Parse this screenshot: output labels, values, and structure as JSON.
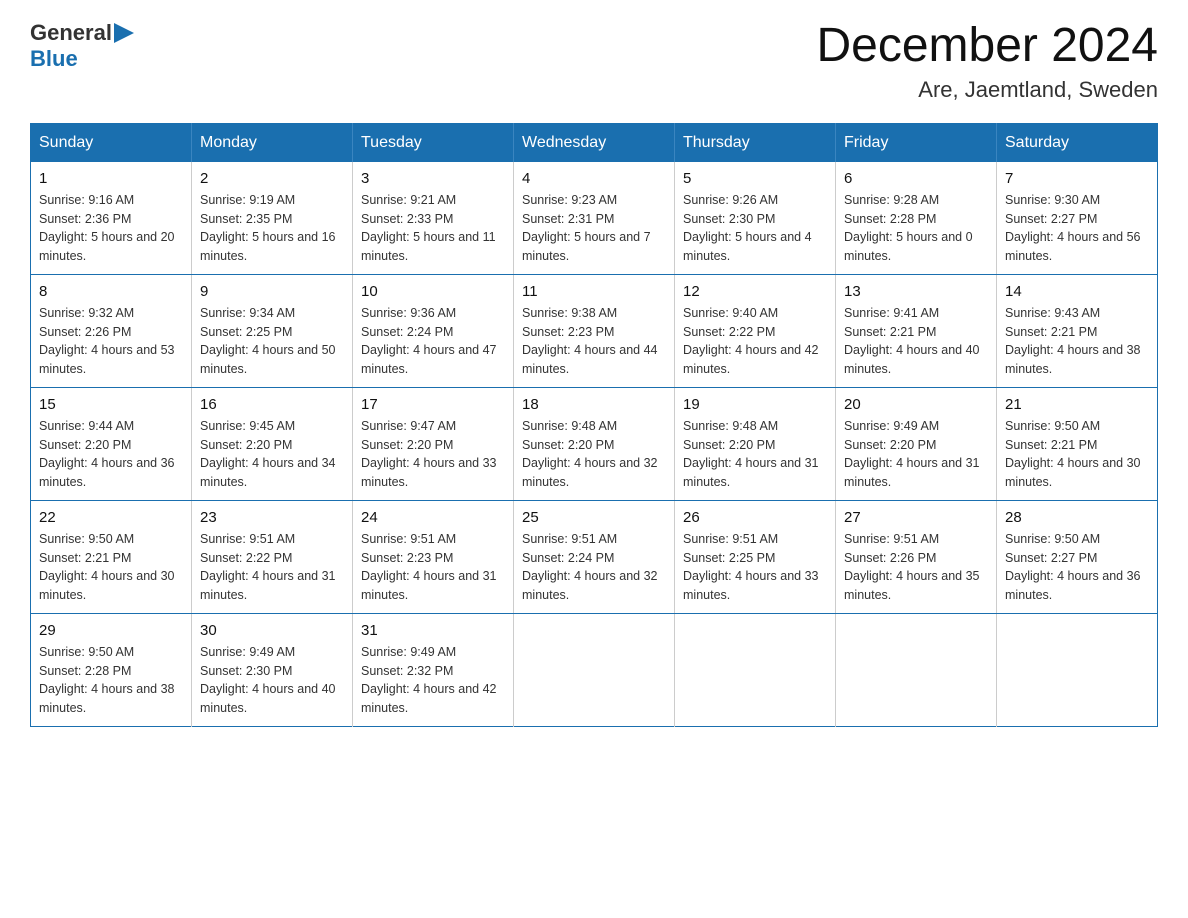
{
  "header": {
    "logo_general": "General",
    "logo_blue": "Blue",
    "month_year": "December 2024",
    "location": "Are, Jaemtland, Sweden"
  },
  "weekdays": [
    "Sunday",
    "Monday",
    "Tuesday",
    "Wednesday",
    "Thursday",
    "Friday",
    "Saturday"
  ],
  "weeks": [
    [
      {
        "day": "1",
        "sunrise": "9:16 AM",
        "sunset": "2:36 PM",
        "daylight": "5 hours and 20 minutes."
      },
      {
        "day": "2",
        "sunrise": "9:19 AM",
        "sunset": "2:35 PM",
        "daylight": "5 hours and 16 minutes."
      },
      {
        "day": "3",
        "sunrise": "9:21 AM",
        "sunset": "2:33 PM",
        "daylight": "5 hours and 11 minutes."
      },
      {
        "day": "4",
        "sunrise": "9:23 AM",
        "sunset": "2:31 PM",
        "daylight": "5 hours and 7 minutes."
      },
      {
        "day": "5",
        "sunrise": "9:26 AM",
        "sunset": "2:30 PM",
        "daylight": "5 hours and 4 minutes."
      },
      {
        "day": "6",
        "sunrise": "9:28 AM",
        "sunset": "2:28 PM",
        "daylight": "5 hours and 0 minutes."
      },
      {
        "day": "7",
        "sunrise": "9:30 AM",
        "sunset": "2:27 PM",
        "daylight": "4 hours and 56 minutes."
      }
    ],
    [
      {
        "day": "8",
        "sunrise": "9:32 AM",
        "sunset": "2:26 PM",
        "daylight": "4 hours and 53 minutes."
      },
      {
        "day": "9",
        "sunrise": "9:34 AM",
        "sunset": "2:25 PM",
        "daylight": "4 hours and 50 minutes."
      },
      {
        "day": "10",
        "sunrise": "9:36 AM",
        "sunset": "2:24 PM",
        "daylight": "4 hours and 47 minutes."
      },
      {
        "day": "11",
        "sunrise": "9:38 AM",
        "sunset": "2:23 PM",
        "daylight": "4 hours and 44 minutes."
      },
      {
        "day": "12",
        "sunrise": "9:40 AM",
        "sunset": "2:22 PM",
        "daylight": "4 hours and 42 minutes."
      },
      {
        "day": "13",
        "sunrise": "9:41 AM",
        "sunset": "2:21 PM",
        "daylight": "4 hours and 40 minutes."
      },
      {
        "day": "14",
        "sunrise": "9:43 AM",
        "sunset": "2:21 PM",
        "daylight": "4 hours and 38 minutes."
      }
    ],
    [
      {
        "day": "15",
        "sunrise": "9:44 AM",
        "sunset": "2:20 PM",
        "daylight": "4 hours and 36 minutes."
      },
      {
        "day": "16",
        "sunrise": "9:45 AM",
        "sunset": "2:20 PM",
        "daylight": "4 hours and 34 minutes."
      },
      {
        "day": "17",
        "sunrise": "9:47 AM",
        "sunset": "2:20 PM",
        "daylight": "4 hours and 33 minutes."
      },
      {
        "day": "18",
        "sunrise": "9:48 AM",
        "sunset": "2:20 PM",
        "daylight": "4 hours and 32 minutes."
      },
      {
        "day": "19",
        "sunrise": "9:48 AM",
        "sunset": "2:20 PM",
        "daylight": "4 hours and 31 minutes."
      },
      {
        "day": "20",
        "sunrise": "9:49 AM",
        "sunset": "2:20 PM",
        "daylight": "4 hours and 31 minutes."
      },
      {
        "day": "21",
        "sunrise": "9:50 AM",
        "sunset": "2:21 PM",
        "daylight": "4 hours and 30 minutes."
      }
    ],
    [
      {
        "day": "22",
        "sunrise": "9:50 AM",
        "sunset": "2:21 PM",
        "daylight": "4 hours and 30 minutes."
      },
      {
        "day": "23",
        "sunrise": "9:51 AM",
        "sunset": "2:22 PM",
        "daylight": "4 hours and 31 minutes."
      },
      {
        "day": "24",
        "sunrise": "9:51 AM",
        "sunset": "2:23 PM",
        "daylight": "4 hours and 31 minutes."
      },
      {
        "day": "25",
        "sunrise": "9:51 AM",
        "sunset": "2:24 PM",
        "daylight": "4 hours and 32 minutes."
      },
      {
        "day": "26",
        "sunrise": "9:51 AM",
        "sunset": "2:25 PM",
        "daylight": "4 hours and 33 minutes."
      },
      {
        "day": "27",
        "sunrise": "9:51 AM",
        "sunset": "2:26 PM",
        "daylight": "4 hours and 35 minutes."
      },
      {
        "day": "28",
        "sunrise": "9:50 AM",
        "sunset": "2:27 PM",
        "daylight": "4 hours and 36 minutes."
      }
    ],
    [
      {
        "day": "29",
        "sunrise": "9:50 AM",
        "sunset": "2:28 PM",
        "daylight": "4 hours and 38 minutes."
      },
      {
        "day": "30",
        "sunrise": "9:49 AM",
        "sunset": "2:30 PM",
        "daylight": "4 hours and 40 minutes."
      },
      {
        "day": "31",
        "sunrise": "9:49 AM",
        "sunset": "2:32 PM",
        "daylight": "4 hours and 42 minutes."
      },
      null,
      null,
      null,
      null
    ]
  ]
}
